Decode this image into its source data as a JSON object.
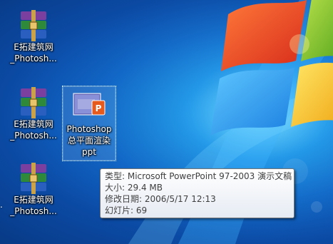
{
  "desktop": {
    "icons": [
      {
        "line1": "E拓建筑网",
        "line2": "_Photosh...",
        "type": "rar"
      },
      {
        "line1": "Photoshop",
        "line2": "总平面渲染",
        "line3": "ppt",
        "type": "ppt",
        "selected": true
      },
      {
        "line1": "E拓建筑网",
        "line2": "_Photosh...",
        "type": "rar"
      },
      {
        "line1": "E拓建筑网",
        "line2": "_Photosh...",
        "type": "rar"
      }
    ],
    "edge_fragment": "."
  },
  "tooltip": {
    "type_line": "类型: Microsoft PowerPoint 97-2003 演示文稿",
    "size_line": "大小: 29.4 MB",
    "modified_line": "修改日期: 2006/5/17 12:13",
    "slides_line": "幻灯片: 69"
  },
  "colors": {
    "wallpaper_primary": "#1167c8",
    "wallpaper_glow": "#5ad0ff",
    "ppt_accent": "#e65a1e",
    "rar_purple": "#7b3fa0"
  }
}
